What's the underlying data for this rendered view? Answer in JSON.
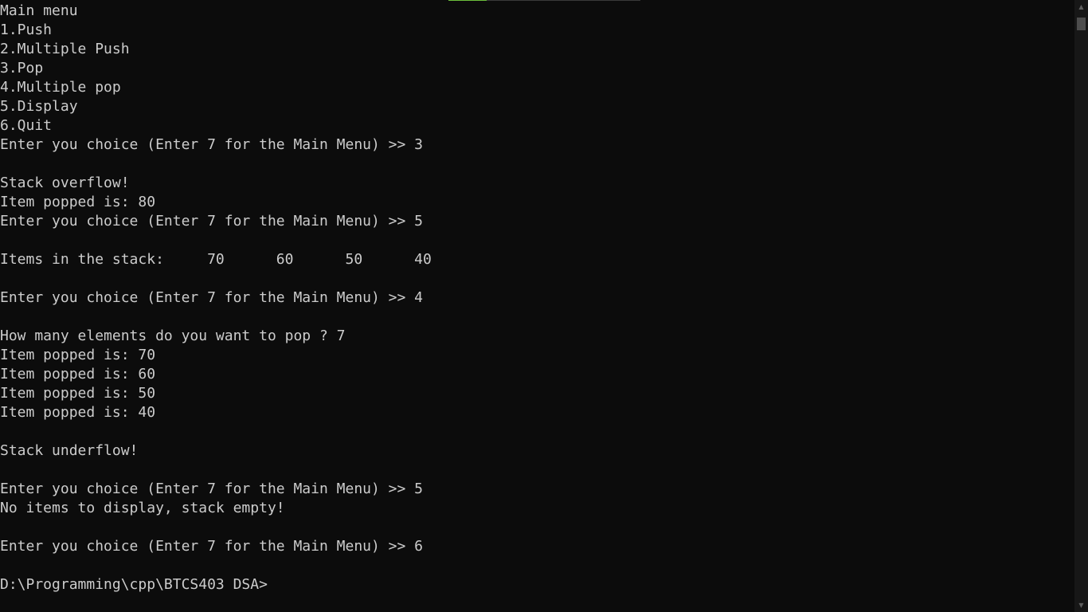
{
  "window": {
    "accent_color": "#6cbf3c",
    "background_color": "#0c0c0c",
    "text_color": "#cccccc"
  },
  "console": {
    "lines": [
      "Main menu",
      "1.Push",
      "2.Multiple Push",
      "3.Pop",
      "4.Multiple pop",
      "5.Display",
      "6.Quit",
      "Enter you choice (Enter 7 for the Main Menu) >> 3",
      "",
      "Stack overflow!",
      "Item popped is: 80",
      "Enter you choice (Enter 7 for the Main Menu) >> 5",
      "",
      "Items in the stack:     70      60      50      40",
      "",
      "Enter you choice (Enter 7 for the Main Menu) >> 4",
      "",
      "How many elements do you want to pop ? 7",
      "Item popped is: 70",
      "Item popped is: 60",
      "Item popped is: 50",
      "Item popped is: 40",
      "",
      "Stack underflow!",
      "",
      "Enter you choice (Enter 7 for the Main Menu) >> 5",
      "No items to display, stack empty!",
      "",
      "Enter you choice (Enter 7 for the Main Menu) >> 6",
      "",
      "D:\\Programming\\cpp\\BTCS403 DSA>"
    ]
  },
  "scrollbar": {
    "up_icon": "scroll-up-arrow-icon",
    "down_icon": "scroll-down-arrow-icon"
  }
}
